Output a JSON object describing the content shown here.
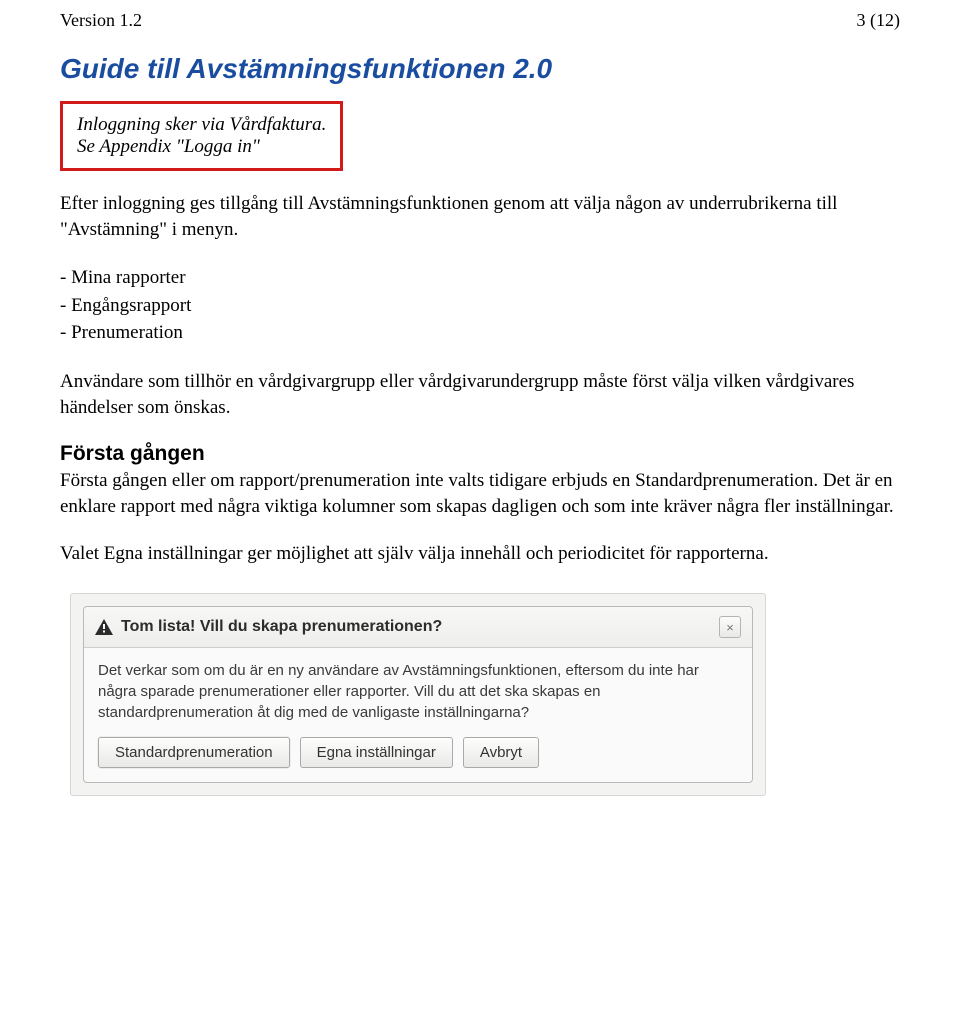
{
  "header": {
    "version": "Version 1.2",
    "page_indicator": "3 (12)"
  },
  "title": "Guide till Avstämningsfunktionen 2.0",
  "red_box": {
    "line1": "Inloggning sker via Vårdfaktura.",
    "line2": "Se Appendix \"Logga in\""
  },
  "intro": "Efter inloggning ges tillgång till Avstämningsfunktionen genom att välja någon av underrubrikerna till \"Avstämning\" i menyn.",
  "list": {
    "item1": "- Mina rapporter",
    "item2": "- Engångsrapport",
    "item3": "- Prenumeration"
  },
  "users_note": "Användare som tillhör en vårdgivargrupp eller vårdgivarundergrupp måste först välja vilken vårdgivares händelser som önskas.",
  "first_time": {
    "heading": "Första gången",
    "p1": "Första gången eller om rapport/prenumeration inte valts tidigare erbjuds en Standardprenumeration. Det är en enklare rapport med några viktiga kolumner som skapas dagligen och som inte kräver några fler inställningar.",
    "p2": "Valet Egna inställningar ger möjlighet att själv välja innehåll och periodicitet för rapporterna."
  },
  "dialog": {
    "title": "Tom lista! Vill du skapa prenumerationen?",
    "body": "Det verkar som om du är en ny användare av Avstämningsfunktionen, eftersom du inte har några sparade prenumerationer eller rapporter. Vill du att det ska skapas en standardprenumeration åt dig med de vanligaste inställningarna?",
    "close_symbol": "×",
    "buttons": {
      "primary": "Standardprenumeration",
      "secondary": "Egna inställningar",
      "cancel": "Avbryt"
    }
  }
}
